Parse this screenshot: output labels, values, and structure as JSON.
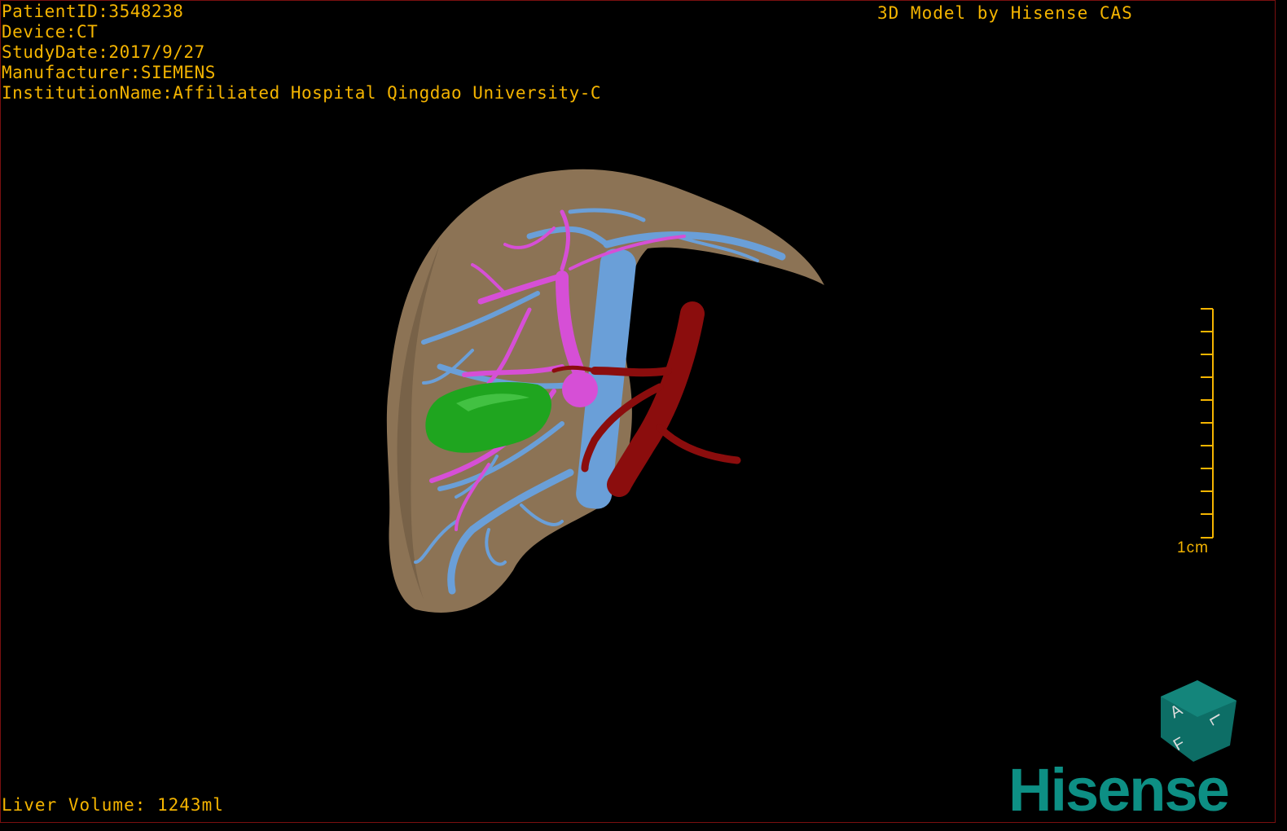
{
  "info": {
    "patient_id": "PatientID:3548238",
    "device": "Device:CT",
    "study_date": "StudyDate:2017/9/27",
    "manufacturer": "Manufacturer:SIEMENS",
    "institution": "InstitutionName:Affiliated Hospital Qingdao University-C"
  },
  "brand_text": "3D Model by Hisense CAS",
  "liver_volume": "Liver Volume: 1243ml",
  "scale_label": "1cm",
  "orientation_cube": {
    "labels": [
      "A",
      "F",
      "L"
    ]
  },
  "logo": {
    "text": "Hisense",
    "color": "#0d8f84"
  },
  "colors": {
    "text": "#f4b400",
    "liver": "#8c7355",
    "portal_vein": "#6a9fd8",
    "hepatic_vessels": "#d64fd6",
    "artery": "#8b0d0d",
    "lesion": "#1fa51f"
  }
}
